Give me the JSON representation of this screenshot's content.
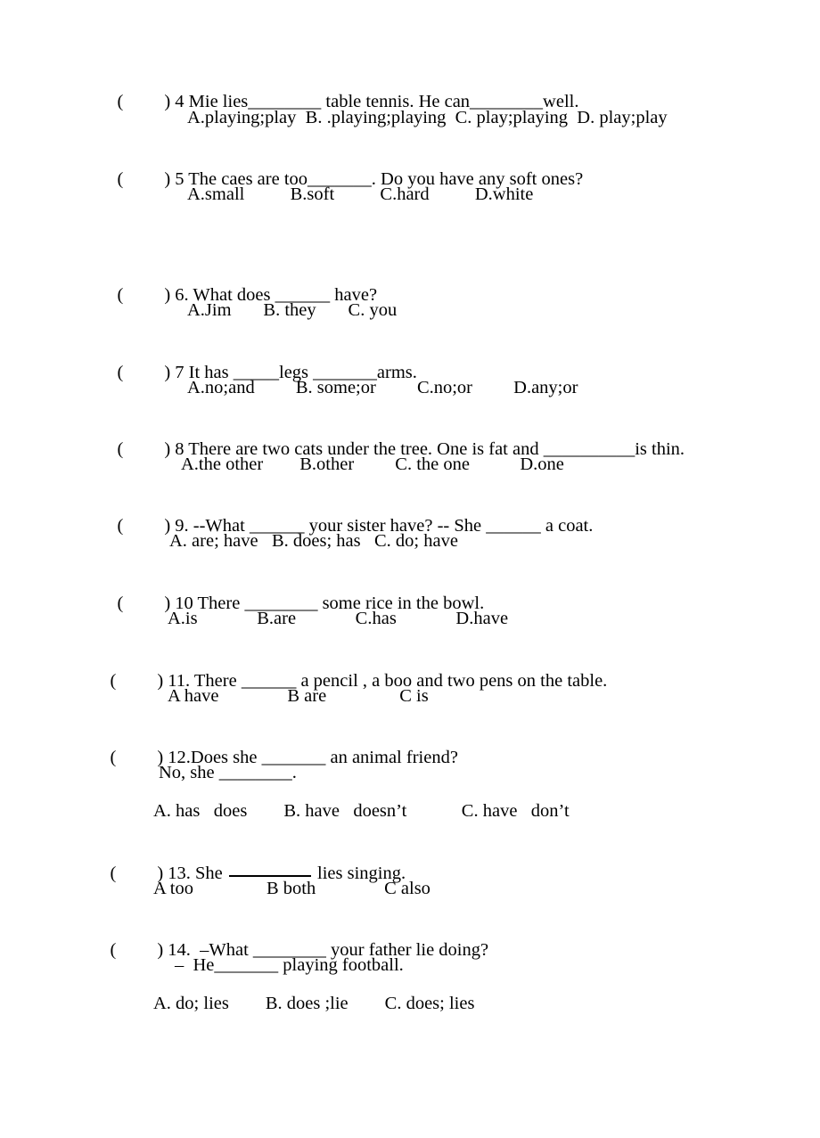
{
  "document": {
    "type": "worksheet",
    "subject": "English grammar multiple choice",
    "background_color": "#ffffff",
    "text_color": "#000000"
  },
  "questions": [
    {
      "id": "q4",
      "marker_open": "(",
      "marker_close": ")",
      "stem": " 4 Mie lies________ table tennis. He can________well.",
      "options_line": "A.playing;play  B. .playing;playing  C. play;playing  D. play;play"
    },
    {
      "id": "q5",
      "marker_open": "(",
      "marker_close": ")",
      "stem": " 5 The caes are too_______. Do you have any soft ones?",
      "options_line": "A.small          B.soft          C.hard          D.white"
    },
    {
      "id": "q6",
      "marker_open": "(",
      "marker_close": ")",
      "stem": " 6. What does ______ have?",
      "options_line": "A.Jim       B. they       C. you"
    },
    {
      "id": "q7",
      "marker_open": "(",
      "marker_close": ")",
      "stem": " 7 It has _____legs _______arms.",
      "options_line": "A.no;and         B. some;or         C.no;or         D.any;or"
    },
    {
      "id": "q8",
      "marker_open": "(",
      "marker_close": ")",
      "stem": " 8 There are two cats under the tree. One is fat and __________is thin.",
      "options_line": "A.the other        B.other         C. the one           D.one"
    },
    {
      "id": "q9",
      "marker_open": "(",
      "marker_close": ")",
      "stem": " 9. --What ______ your sister have? -- She ______ a coat.",
      "options_line": "A. are; have   B. does; has   C. do; have"
    },
    {
      "id": "q10",
      "marker_open": "(",
      "marker_close": ")",
      "stem": " 10 There ________ some rice in the bowl.",
      "options_line": "A.is             B.are             C.has             D.have"
    },
    {
      "id": "q11",
      "marker_open": "(",
      "marker_close": ")",
      "stem": " 11. There ______ a pencil , a boo and two pens on the table.",
      "options_line": "A have               B are                C is"
    },
    {
      "id": "q12",
      "marker_open": "(",
      "marker_close": ")",
      "stem": " 12.Does she _______ an animal friend?",
      "sub_line": "No, she ________.",
      "options_line": "A. has   does        B. have   doesn’t            C. have   don’t"
    },
    {
      "id": "q13",
      "marker_open": "(",
      "marker_close": ")",
      "stem_before_rule": " 13. She ",
      "stem_after_rule": " lies singing.",
      "options_line": "A too                B both               C also"
    },
    {
      "id": "q14",
      "marker_open": "(",
      "marker_close": ")",
      "stem": " 14.  –What ________ your father lie doing?",
      "sub_line": "–  He_______ playing football.",
      "options_line": "A. do; lies        B. does ;lie        C. does; lies"
    }
  ]
}
